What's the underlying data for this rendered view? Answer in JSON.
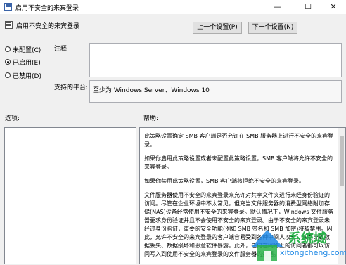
{
  "window": {
    "title": "启用不安全的来宾登录",
    "minimize": "—",
    "maximize": "☐",
    "close": "✕"
  },
  "header": {
    "policy_name": "启用不安全的来宾登录",
    "prev_button": "上一个设置(P)",
    "next_button": "下一个设置(N)"
  },
  "options": [
    {
      "label": "未配置(C)",
      "checked": false
    },
    {
      "label": "已启用(E)",
      "checked": true
    },
    {
      "label": "已禁用(D)",
      "checked": false
    }
  ],
  "comment_label": "注释:",
  "platform_label": "支持的平台:",
  "platform_value": "至少为 Windows Server、Windows 10",
  "options_label": "选项:",
  "help_label": "帮助:",
  "help_paragraphs": [
    "此策略设置确定 SMB 客户端是否允许在 SMB 服务器上进行不安全的来宾登录。",
    "如果你启用此策略设置或者未配置此策略设置，SMB 客户端将允许不安全的来宾登录。",
    "如果你禁用此策略设置，SMB 客户端将拒绝不安全的来宾登录。",
    "文件服务器使用不安全的来宾登录来允许对共享文件夹进行未经身份验证的访问。尽管在企业环境中不太常见，但充当文件服务器的消费型网络附加存储(NAS)设备经常使用不安全的来宾登录。默认情况下，Windows 文件服务器要求身份验证并且不会使用不安全的来宾登录。由于不安全的来宾登录未经过身份验证，重要的安全功能(例如 SMB 签名和 SMB 加密)将被禁用。因此，允许不安全的来宾登录的客户端容易受到各种中间人攻击，从而导致数据丢失、数据损坏和恶意软件暴露。此外，任何在网络上的访问者都可以访问写入到使用不安全的来宾登录的文件服务器的数据。"
  ],
  "watermark": {
    "text": "系统城",
    "url": "xitongcheng.com"
  },
  "colors": {
    "background": "#f0f0f0",
    "textbox": "#ffffff",
    "watermark_green": "#2ab24a",
    "watermark_blue": "#1e88e5"
  }
}
